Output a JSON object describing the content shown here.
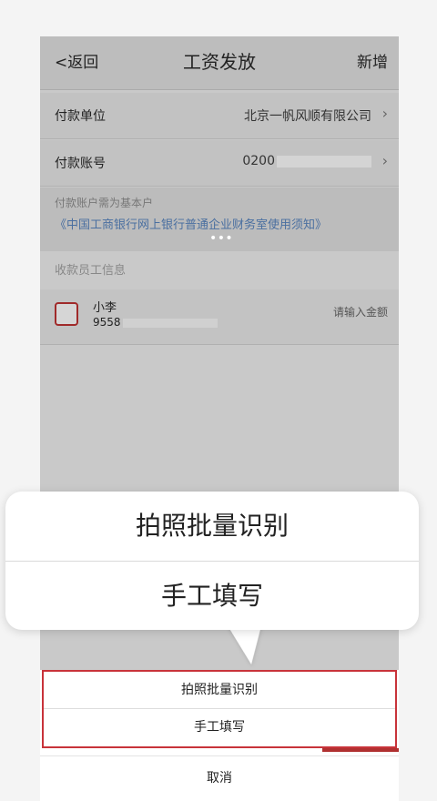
{
  "nav": {
    "back": "<返回",
    "title": "工资发放",
    "add": "新增"
  },
  "payer": {
    "unit_label": "付款单位",
    "unit_value": "北京一帆风顺有限公司",
    "account_label": "付款账号",
    "account_value": "0200"
  },
  "notice": {
    "hint": "付款账户需为基本户",
    "link": "《中国工商银行网上银行普通企业财务室使用须知》"
  },
  "employees": {
    "section_title": "收款员工信息",
    "items": [
      {
        "name": "小李",
        "account": "9558",
        "amount_placeholder": "请输入金额"
      }
    ]
  },
  "sheet": {
    "option1": "拍照批量识别",
    "option2": "手工填写",
    "cancel": "取消"
  },
  "callout": {
    "option1": "拍照批量识别",
    "option2": "手工填写"
  },
  "colors": {
    "accent": "#c8333a",
    "link": "#4a6fa0"
  }
}
